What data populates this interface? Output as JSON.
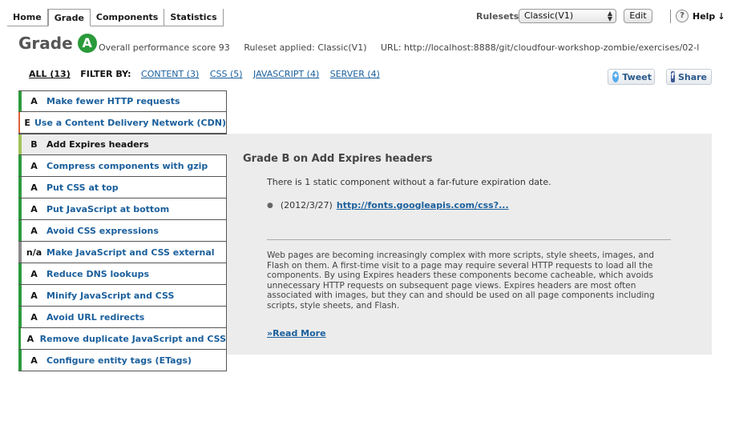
{
  "nav": {
    "tabs": [
      "Home",
      "Grade",
      "Components",
      "Statistics"
    ],
    "active_tab": "Grade",
    "rulesets_label": "Rulesets",
    "ruleset_selected": "Classic(V1)",
    "edit_label": "Edit",
    "help_label": "Help",
    "help_arrow": "↓"
  },
  "header": {
    "grade_word": "Grade",
    "grade_letter": "A",
    "score_text": "Overall performance score 93",
    "ruleset_text": "Ruleset applied: Classic(V1)",
    "url_text": "URL: http://localhost:8888/git/cloudfour-workshop-zombie/exercises/02-l"
  },
  "filter": {
    "all_label": "ALL (13)",
    "filter_by_label": "FILTER BY:",
    "links": [
      "CONTENT (3)",
      "CSS (5)",
      "JAVASCRIPT (4)",
      "SERVER (4)"
    ]
  },
  "social": {
    "tweet_label": "Tweet",
    "share_label": "Share"
  },
  "rules": [
    {
      "grade": "A",
      "name": "Make fewer HTTP requests",
      "color": "#2e9a3e"
    },
    {
      "grade": "E",
      "name": "Use a Content Delivery Network (CDN)",
      "color": "#e0603a"
    },
    {
      "grade": "B",
      "name": "Add Expires headers",
      "color": "#9fc45a"
    },
    {
      "grade": "A",
      "name": "Compress components with gzip",
      "color": "#2e9a3e"
    },
    {
      "grade": "A",
      "name": "Put CSS at top",
      "color": "#2e9a3e"
    },
    {
      "grade": "A",
      "name": "Put JavaScript at bottom",
      "color": "#2e9a3e"
    },
    {
      "grade": "A",
      "name": "Avoid CSS expressions",
      "color": "#2e9a3e"
    },
    {
      "grade": "n/a",
      "name": "Make JavaScript and CSS external",
      "color": "#8a8a8a"
    },
    {
      "grade": "A",
      "name": "Reduce DNS lookups",
      "color": "#2e9a3e"
    },
    {
      "grade": "A",
      "name": "Minify JavaScript and CSS",
      "color": "#2e9a3e"
    },
    {
      "grade": "A",
      "name": "Avoid URL redirects",
      "color": "#2e9a3e"
    },
    {
      "grade": "A",
      "name": "Remove duplicate JavaScript and CSS",
      "color": "#2e9a3e"
    },
    {
      "grade": "A",
      "name": "Configure entity tags (ETags)",
      "color": "#2e9a3e"
    }
  ],
  "selected_rule_index": 2,
  "detail": {
    "title": "Grade B on Add Expires headers",
    "message": "There is 1 static component without a far-future expiration date.",
    "item_date": "(2012/3/27)",
    "item_link": "http://fonts.googleapis.com/css?...",
    "description": "Web pages are becoming increasingly complex with more scripts, style sheets, images, and Flash on them. A first-time visit to a page may require several HTTP requests to load all the components. By using Expires headers these components become cacheable, which avoids unnecessary HTTP requests on subsequent page views. Expires headers are most often associated with images, but they can and should be used on all page components including scripts, style sheets, and Flash.",
    "read_more": "»Read More"
  }
}
